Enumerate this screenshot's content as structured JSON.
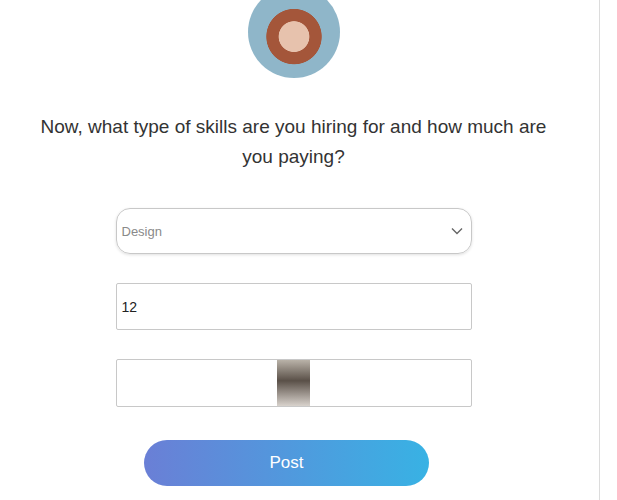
{
  "form": {
    "question": "Now, what type of skills are you hiring for and how much are you paying?",
    "skill_select": {
      "value": "Design"
    },
    "pay_input": {
      "value": "12"
    },
    "post_button": {
      "label": "Post"
    }
  }
}
